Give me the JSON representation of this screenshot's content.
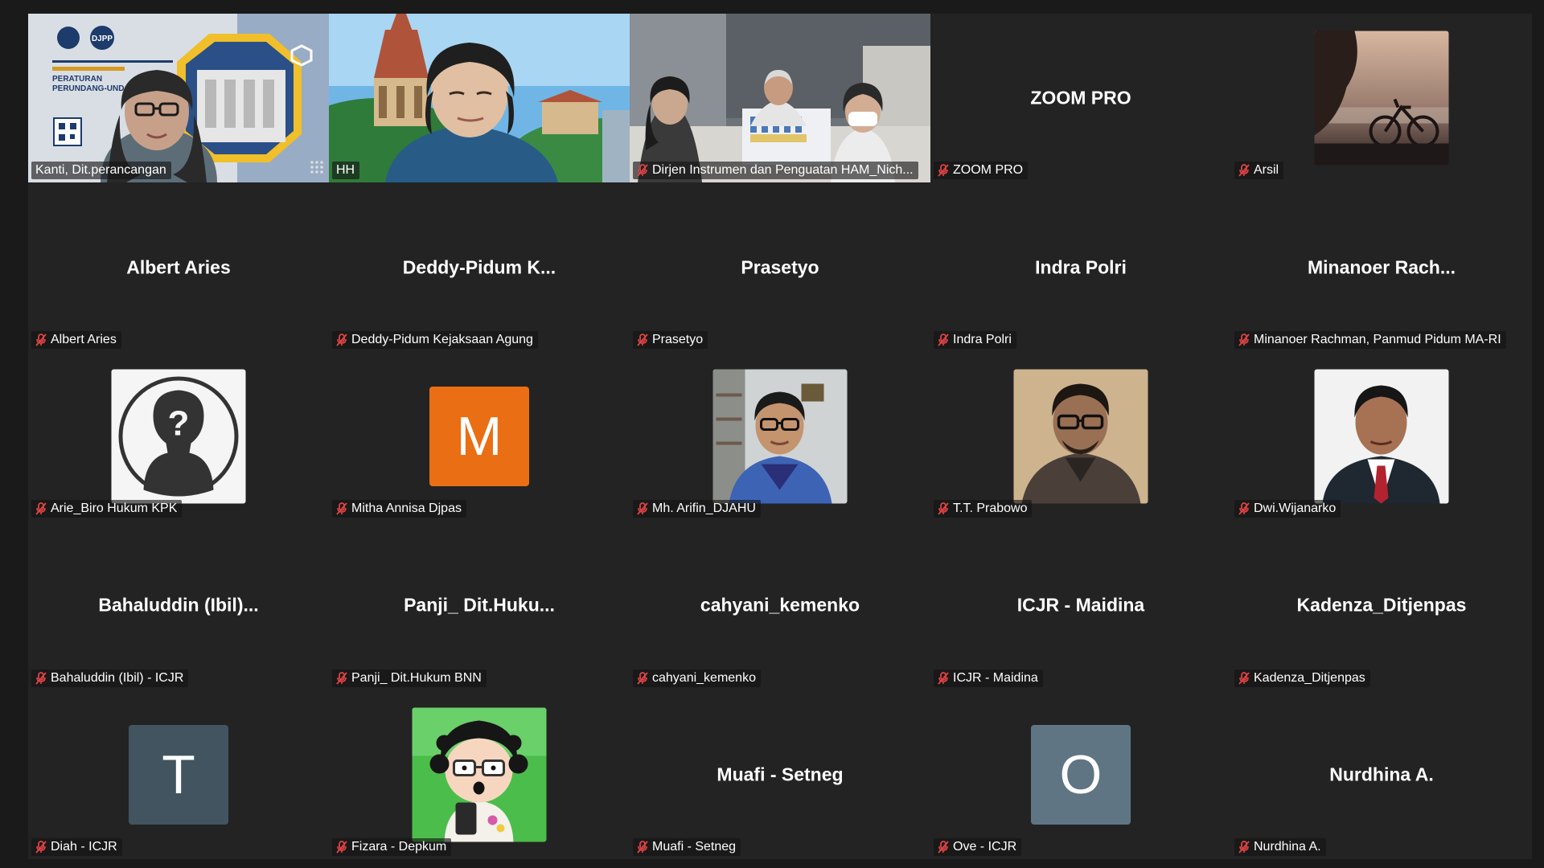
{
  "meeting": {
    "app": "Zoom",
    "view": "gallery",
    "active_speaker_color": "#2fd680",
    "muted_icon_color": "#e04343"
  },
  "tiles": [
    {
      "name": "Kanti, Dit.perancangan",
      "muted": false,
      "kind": "video"
    },
    {
      "name": "HH",
      "muted": false,
      "kind": "video"
    },
    {
      "name": "Dirjen Instrumen dan Penguatan HAM_Nich...",
      "muted": true,
      "kind": "video"
    },
    {
      "name": "ZOOM PRO",
      "display_name": "ZOOM PRO",
      "muted": true,
      "kind": "name"
    },
    {
      "name": "Arsil",
      "muted": true,
      "kind": "photo"
    },
    {
      "name": "Albert Aries",
      "display_name": "Albert Aries",
      "muted": true,
      "kind": "name"
    },
    {
      "name": "Deddy-Pidum Kejaksaan Agung",
      "display_name": "Deddy-Pidum  K...",
      "muted": true,
      "kind": "name"
    },
    {
      "name": "Prasetyo",
      "display_name": "Prasetyo",
      "muted": true,
      "kind": "name"
    },
    {
      "name": "Indra Polri",
      "display_name": "Indra Polri",
      "muted": true,
      "kind": "name"
    },
    {
      "name": "Minanoer Rachman, Panmud Pidum MA-RI",
      "display_name": "Minanoer  Rach...",
      "muted": true,
      "kind": "name"
    },
    {
      "name": "Arie_Biro Hukum KPK",
      "muted": true,
      "kind": "photo"
    },
    {
      "name": "Mitha Annisa Djpas",
      "muted": true,
      "kind": "letter",
      "letter": "M",
      "avatar_color": "#ea6e13"
    },
    {
      "name": "Mh. Arifin_DJAHU",
      "muted": true,
      "kind": "photo"
    },
    {
      "name": "T.T. Prabowo",
      "muted": true,
      "kind": "photo"
    },
    {
      "name": "Dwi.Wijanarko",
      "muted": true,
      "kind": "photo"
    },
    {
      "name": "Bahaluddin (Ibil) - ICJR",
      "display_name": "Bahaluddin  (Ibil)...",
      "muted": true,
      "kind": "name"
    },
    {
      "name": "Panji_ Dit.Hukum BNN",
      "display_name": "Panji_  Dit.Huku...",
      "muted": true,
      "kind": "name"
    },
    {
      "name": "cahyani_kemenko",
      "display_name": "cahyani_kemenko",
      "muted": true,
      "kind": "name"
    },
    {
      "name": "ICJR - Maidina",
      "display_name": "ICJR - Maidina",
      "muted": true,
      "kind": "name"
    },
    {
      "name": "Kadenza_Ditjenpas",
      "display_name": "Kadenza_Ditjenpas",
      "muted": true,
      "kind": "name"
    },
    {
      "name": "Diah - ICJR",
      "muted": true,
      "kind": "letter",
      "letter": "T",
      "avatar_color": "#415460"
    },
    {
      "name": "Fizara - Depkum",
      "muted": true,
      "kind": "photo"
    },
    {
      "name": "Muafi - Setneg",
      "display_name": "Muafi - Setneg",
      "muted": true,
      "kind": "name"
    },
    {
      "name": "Ove - ICJR",
      "muted": true,
      "kind": "letter",
      "letter": "O",
      "avatar_color": "#5f7584"
    },
    {
      "name": "Nurdhina A.",
      "display_name": "Nurdhina A.",
      "muted": true,
      "kind": "name"
    }
  ]
}
